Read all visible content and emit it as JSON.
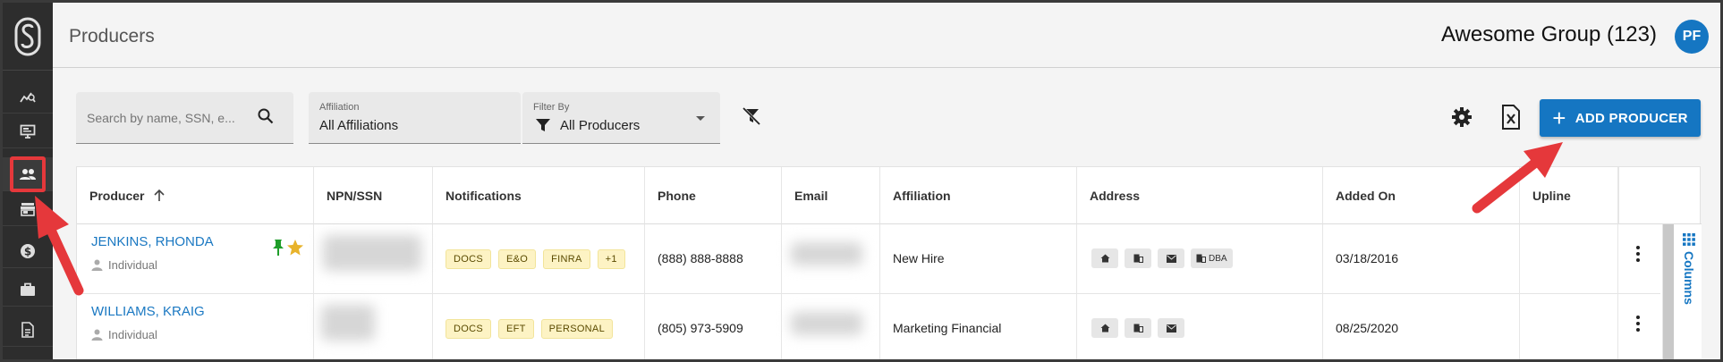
{
  "app": {
    "page_title": "Producers",
    "group_name": "Awesome Group (123)",
    "user_initials": "PF"
  },
  "colors": {
    "brand_blue": "#1576c2",
    "sidebar_bg": "#2d2d2d",
    "highlight_red": "#e5383b",
    "badge_bg": "#fdf3c4"
  },
  "sidebar": {
    "items": [
      {
        "icon": "analytics-icon"
      },
      {
        "icon": "monitor-icon"
      },
      {
        "icon": "people-icon",
        "active": true
      },
      {
        "icon": "store-icon"
      },
      {
        "icon": "dollar-icon"
      },
      {
        "icon": "briefcase-icon"
      },
      {
        "icon": "document-icon"
      }
    ]
  },
  "toolbar": {
    "search_placeholder": "Search by name, SSN, e...",
    "affiliation_label": "Affiliation",
    "affiliation_value": "All Affiliations",
    "filter_label": "Filter By",
    "filter_value": "All Producers",
    "add_button_label": "ADD PRODUCER"
  },
  "table": {
    "columns": [
      "Producer",
      "NPN/SSN",
      "Notifications",
      "Phone",
      "Email",
      "Affiliation",
      "Address",
      "Added On",
      "Upline"
    ],
    "columns_button_label": "Columns",
    "rows": [
      {
        "name": "JENKINS, RHONDA",
        "type": "Individual",
        "pinned": true,
        "starred": true,
        "notifications": [
          "DOCS",
          "E&O",
          "FINRA",
          "+1"
        ],
        "phone": "(888) 888-8888",
        "affiliation": "New Hire",
        "address_chips": [
          "home",
          "building",
          "mail",
          "DBA"
        ],
        "added_on": "03/18/2016",
        "upline": ""
      },
      {
        "name": "WILLIAMS, KRAIG",
        "type": "Individual",
        "pinned": false,
        "starred": false,
        "notifications": [
          "DOCS",
          "EFT",
          "PERSONAL"
        ],
        "phone": "(805) 973-5909",
        "affiliation": "Marketing Financial",
        "address_chips": [
          "home",
          "building",
          "mail"
        ],
        "added_on": "08/25/2020",
        "upline": ""
      }
    ]
  }
}
